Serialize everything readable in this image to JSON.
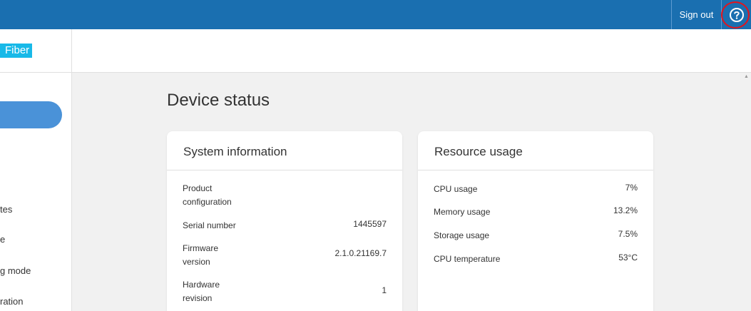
{
  "topbar": {
    "signout_label": "Sign out"
  },
  "sidebar": {
    "logo_text": "Fiber",
    "items": [
      {
        "label": "tes"
      },
      {
        "label": "e"
      },
      {
        "label": "g mode"
      },
      {
        "label": "ration"
      }
    ]
  },
  "page": {
    "title": "Device status"
  },
  "system_info": {
    "title": "System information",
    "rows": [
      {
        "label": "Product configuration",
        "value": ""
      },
      {
        "label": "Serial number",
        "value": "1445597"
      },
      {
        "label": "Firmware version",
        "value": "2.1.0.21169.7"
      },
      {
        "label": "Hardware revision",
        "value": "1"
      }
    ]
  },
  "resource_usage": {
    "title": "Resource usage",
    "rows": [
      {
        "label": "CPU usage",
        "value": "7%"
      },
      {
        "label": "Memory usage",
        "value": "13.2%"
      },
      {
        "label": "Storage usage",
        "value": "7.5%"
      },
      {
        "label": "CPU temperature",
        "value": "53°C"
      }
    ]
  },
  "colors": {
    "topbar": "#1a6fb0",
    "logo_bg": "#18b9e8",
    "active_nav": "#4a92d8",
    "highlight_ring": "#e3141c"
  },
  "icons": {
    "help": "question-circle-icon"
  }
}
